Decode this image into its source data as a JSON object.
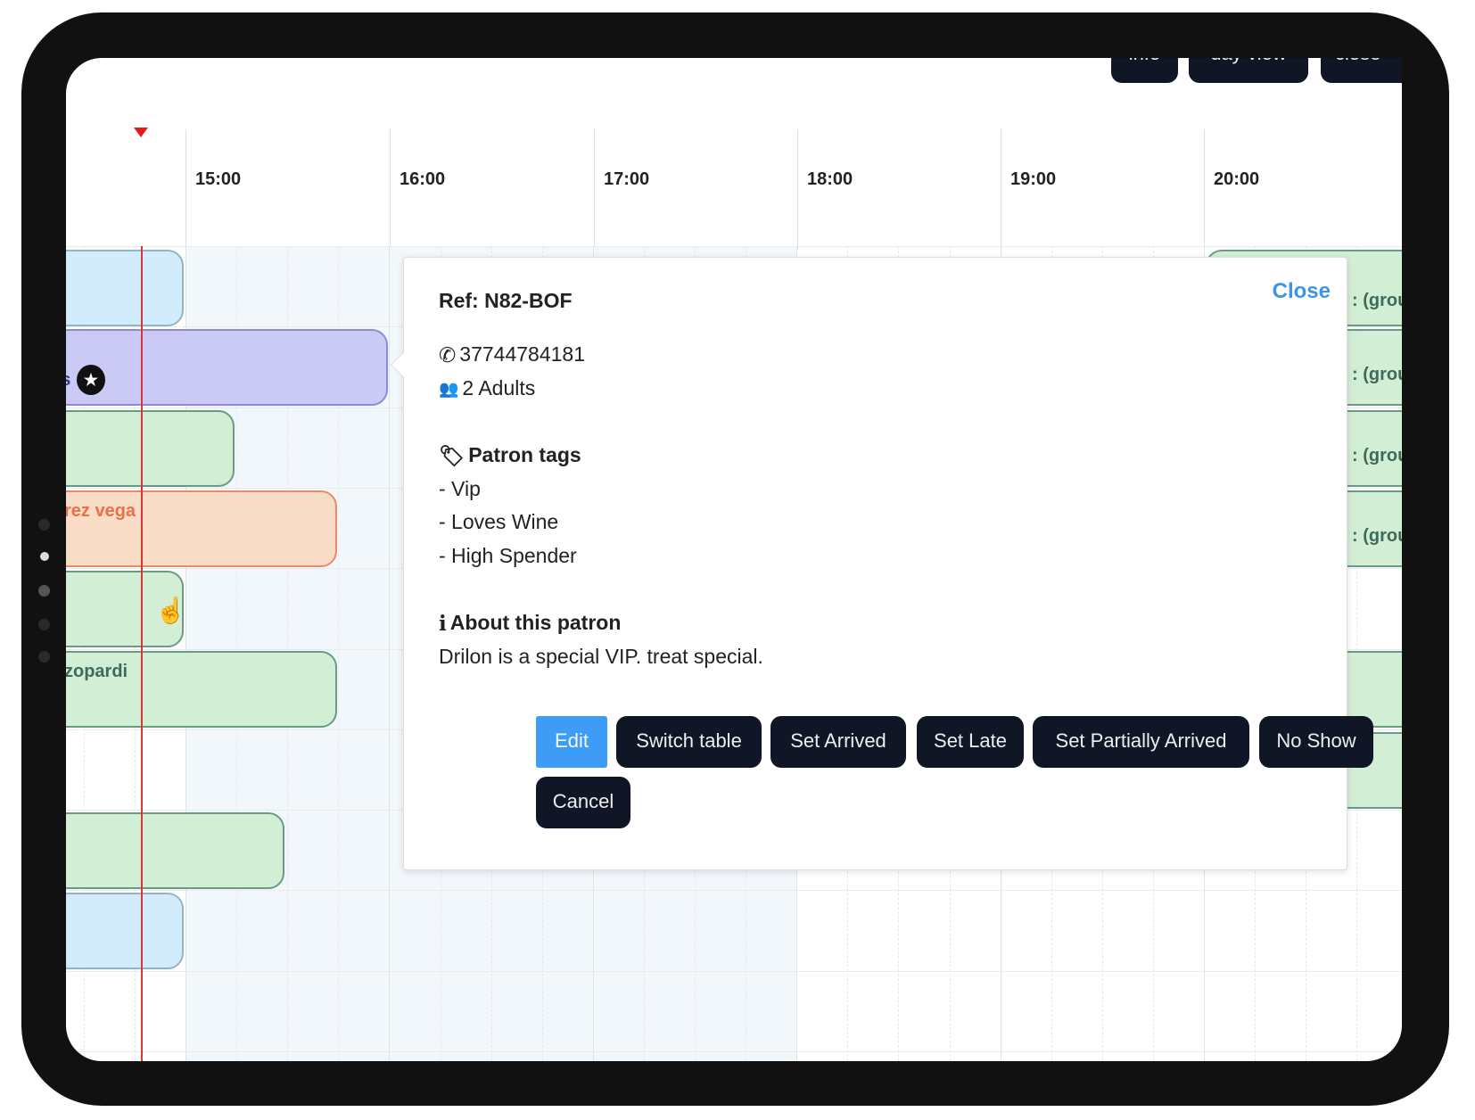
{
  "top_buttons": [
    "info",
    "day view",
    "close"
  ],
  "timeline": {
    "hours": [
      "15:00",
      "16:00",
      "17:00",
      "18:00",
      "19:00",
      "20:00"
    ]
  },
  "bars_left": [
    "lts",
    "rez vega",
    "zopardi"
  ],
  "bars_right_label": ": (grou",
  "popup": {
    "ref": "Ref: N82-BOF",
    "close": "Close",
    "phone": "37744784181",
    "guests": "2 Adults",
    "tags_title": "Patron tags",
    "tags": [
      "- Vip",
      "- Loves Wine",
      "- High Spender"
    ],
    "about_title": "About this patron",
    "about_text": "Drilon is a special VIP. treat special.",
    "buttons": [
      "Edit",
      "Switch table",
      "Set Arrived",
      "Set Late",
      "Set Partially Arrived",
      "No Show",
      "Cancel"
    ]
  },
  "colors": {
    "accent": "#3d9cf5",
    "button_dark": "#111627",
    "now_line": "#d8373a",
    "link": "#3a96e8"
  },
  "icons": [
    "phone-icon",
    "users-icon",
    "tag-icon",
    "info-icon",
    "star-icon",
    "hand-cursor-icon"
  ]
}
